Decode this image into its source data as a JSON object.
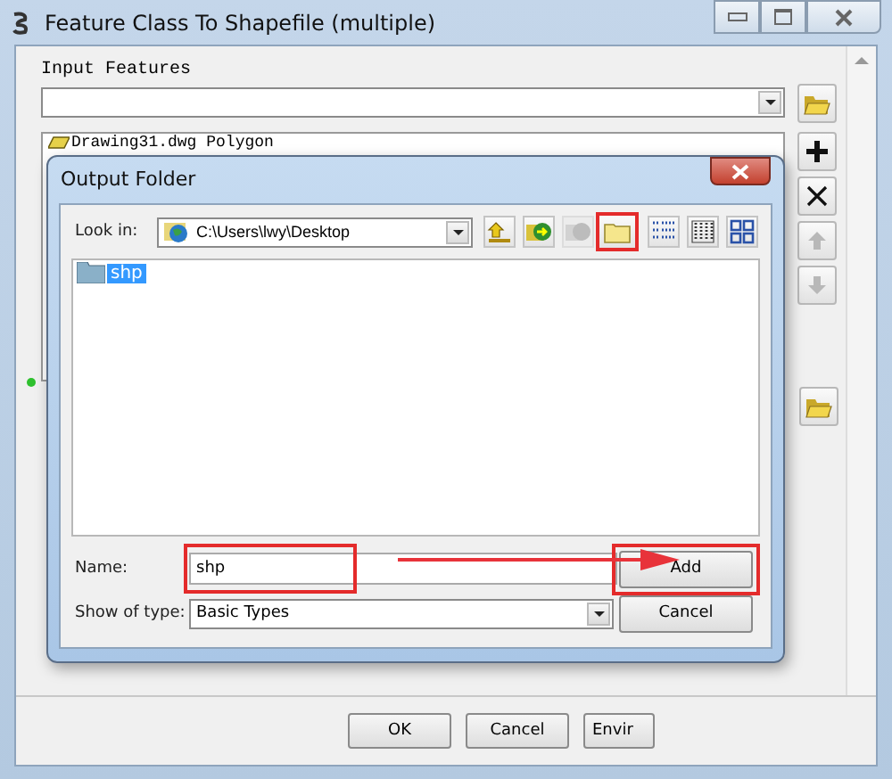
{
  "window": {
    "title": "Feature Class To Shapefile (multiple)"
  },
  "input_features": {
    "label": "Input Features",
    "items": [
      {
        "name": "Drawing31.dwg Polygon"
      }
    ]
  },
  "side_buttons": [
    {
      "kind": "add",
      "disabled": false
    },
    {
      "kind": "remove",
      "disabled": false
    },
    {
      "kind": "up",
      "disabled": true
    },
    {
      "kind": "down",
      "disabled": true
    }
  ],
  "dialog": {
    "title": "Output Folder",
    "look_in_label": "Look in:",
    "look_in_value": "C:\\Users\\lwy\\Desktop",
    "toolbar": [
      {
        "kind": "up-level",
        "disabled": false,
        "highlighted": false
      },
      {
        "kind": "connect",
        "disabled": false,
        "highlighted": false
      },
      {
        "kind": "disconnect",
        "disabled": true,
        "highlighted": false
      },
      {
        "kind": "new-folder",
        "disabled": false,
        "highlighted": true
      },
      {
        "kind": "list",
        "disabled": false,
        "highlighted": false
      },
      {
        "kind": "details",
        "disabled": false,
        "highlighted": false
      },
      {
        "kind": "thumbnails",
        "disabled": false,
        "highlighted": false
      }
    ],
    "items": [
      {
        "name": "shp",
        "selected": true
      }
    ],
    "name_label": "Name:",
    "name_value": "shp",
    "name_highlighted": true,
    "type_label": "Show of type:",
    "type_value": "Basic Types",
    "buttons": [
      {
        "label": "Add",
        "highlighted": true
      },
      {
        "label": "Cancel",
        "highlighted": false
      }
    ]
  },
  "buttons": [
    "OK",
    "Cancel",
    "Envir"
  ]
}
